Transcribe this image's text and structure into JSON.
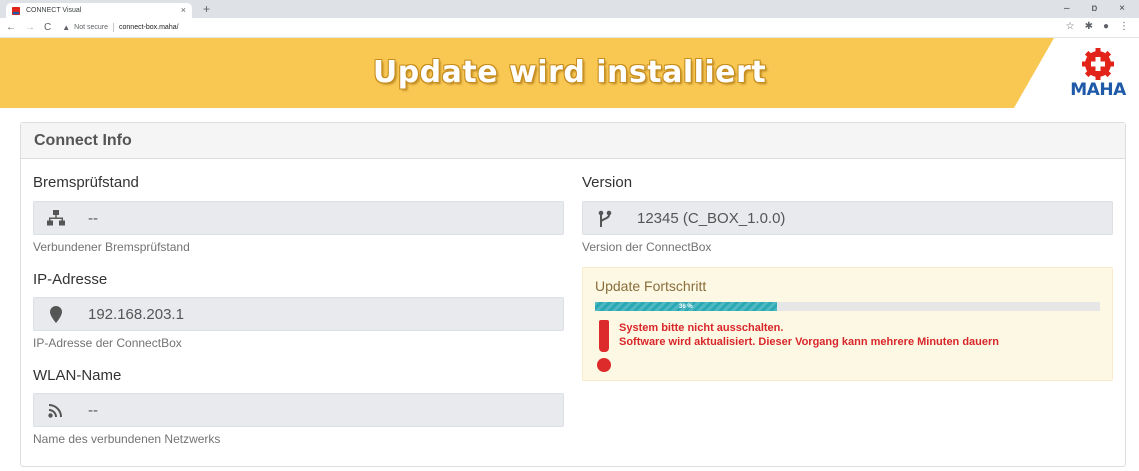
{
  "browser": {
    "tab_title": "CONNECT Visual",
    "tab_close": "×",
    "new_tab": "+",
    "not_secure": "Not secure",
    "url": "connect-box.maha/",
    "window_controls": {
      "minimize": "–",
      "maximize": "ɒ",
      "close": "×"
    }
  },
  "header": {
    "title": "Update wird installiert",
    "logo_text": "MAHA",
    "colors": {
      "background": "#f9c853",
      "logo_red": "#e2231a",
      "logo_blue": "#1e5aa8"
    }
  },
  "panel": {
    "heading": "Connect Info"
  },
  "fields": {
    "brake": {
      "label": "Bremsprüfstand",
      "value": "--",
      "help": "Verbundener Bremsprüfstand",
      "icon": "network-icon"
    },
    "ip": {
      "label": "IP-Adresse",
      "value": "192.168.203.1",
      "help": "IP-Adresse der ConnectBox",
      "icon": "location-pin-icon"
    },
    "wlan": {
      "label": "WLAN-Name",
      "value": "--",
      "help": "Name des verbundenen Netzwerks",
      "icon": "wifi-icon"
    },
    "version": {
      "label": "Version",
      "value": "12345 (C_BOX_1.0.0)",
      "help": "Version der ConnectBox",
      "icon": "branch-icon"
    }
  },
  "update": {
    "title": "Update Fortschritt",
    "progress_percent": 36,
    "progress_label": "36 %",
    "warning_line1": "System bitte nicht ausschalten.",
    "warning_line2": "Software wird aktualisiert. Dieser Vorgang kann mehrere Minuten dauern",
    "colors": {
      "progress": "#2aa8b4",
      "warning_text": "#d9262b",
      "alert_bg": "#fcf8e3"
    }
  }
}
